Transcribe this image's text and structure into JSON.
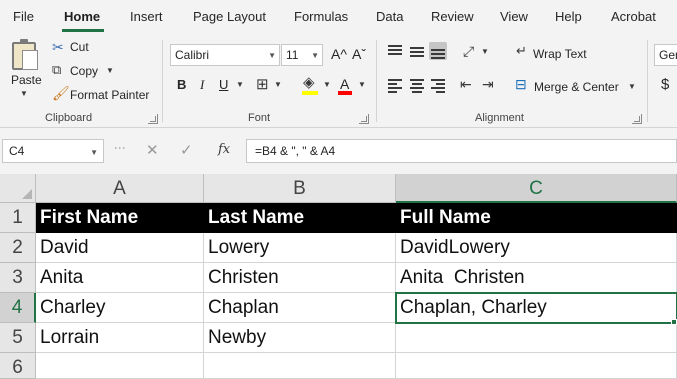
{
  "menu": {
    "items": [
      "File",
      "Home",
      "Insert",
      "Page Layout",
      "Formulas",
      "Data",
      "Review",
      "View",
      "Help",
      "Acrobat"
    ],
    "active": "Home"
  },
  "ribbon": {
    "clipboard": {
      "paste_label": "Paste",
      "cut_label": "Cut",
      "copy_label": "Copy",
      "format_painter_label": "Format Painter",
      "group_label": "Clipboard"
    },
    "font": {
      "font_name": "Calibri",
      "font_size": "11",
      "grow_label": "A^",
      "shrink_label": "Aˇ",
      "bold": "B",
      "italic": "I",
      "underline": "U",
      "font_color_letter": "A",
      "group_label": "Font"
    },
    "alignment": {
      "wrap_text_label": "Wrap Text",
      "merge_center_label": "Merge & Center",
      "group_label": "Alignment"
    },
    "number": {
      "format_partial": "Gen",
      "currency_symbol": "$"
    }
  },
  "formula_bar": {
    "name_box": "C4",
    "fx": "fx",
    "formula": "=B4 & \", \" & A4"
  },
  "sheet": {
    "columns": [
      "A",
      "B",
      "C"
    ],
    "rows": [
      "1",
      "2",
      "3",
      "4",
      "5",
      "6"
    ],
    "selected_column": "C",
    "selected_row": "4",
    "cells": [
      [
        "First Name",
        "Last Name",
        "Full Name"
      ],
      [
        "David",
        "Lowery",
        "DavidLowery"
      ],
      [
        "Anita",
        "Christen",
        "Anita  Christen"
      ],
      [
        "Charley",
        "Chaplan",
        "Chaplan, Charley"
      ],
      [
        "Lorrain",
        "Newby",
        ""
      ],
      [
        "",
        "",
        ""
      ]
    ]
  },
  "colors": {
    "accent": "#217346",
    "header_row_bg": "#000000",
    "header_row_text": "#ffffff"
  }
}
